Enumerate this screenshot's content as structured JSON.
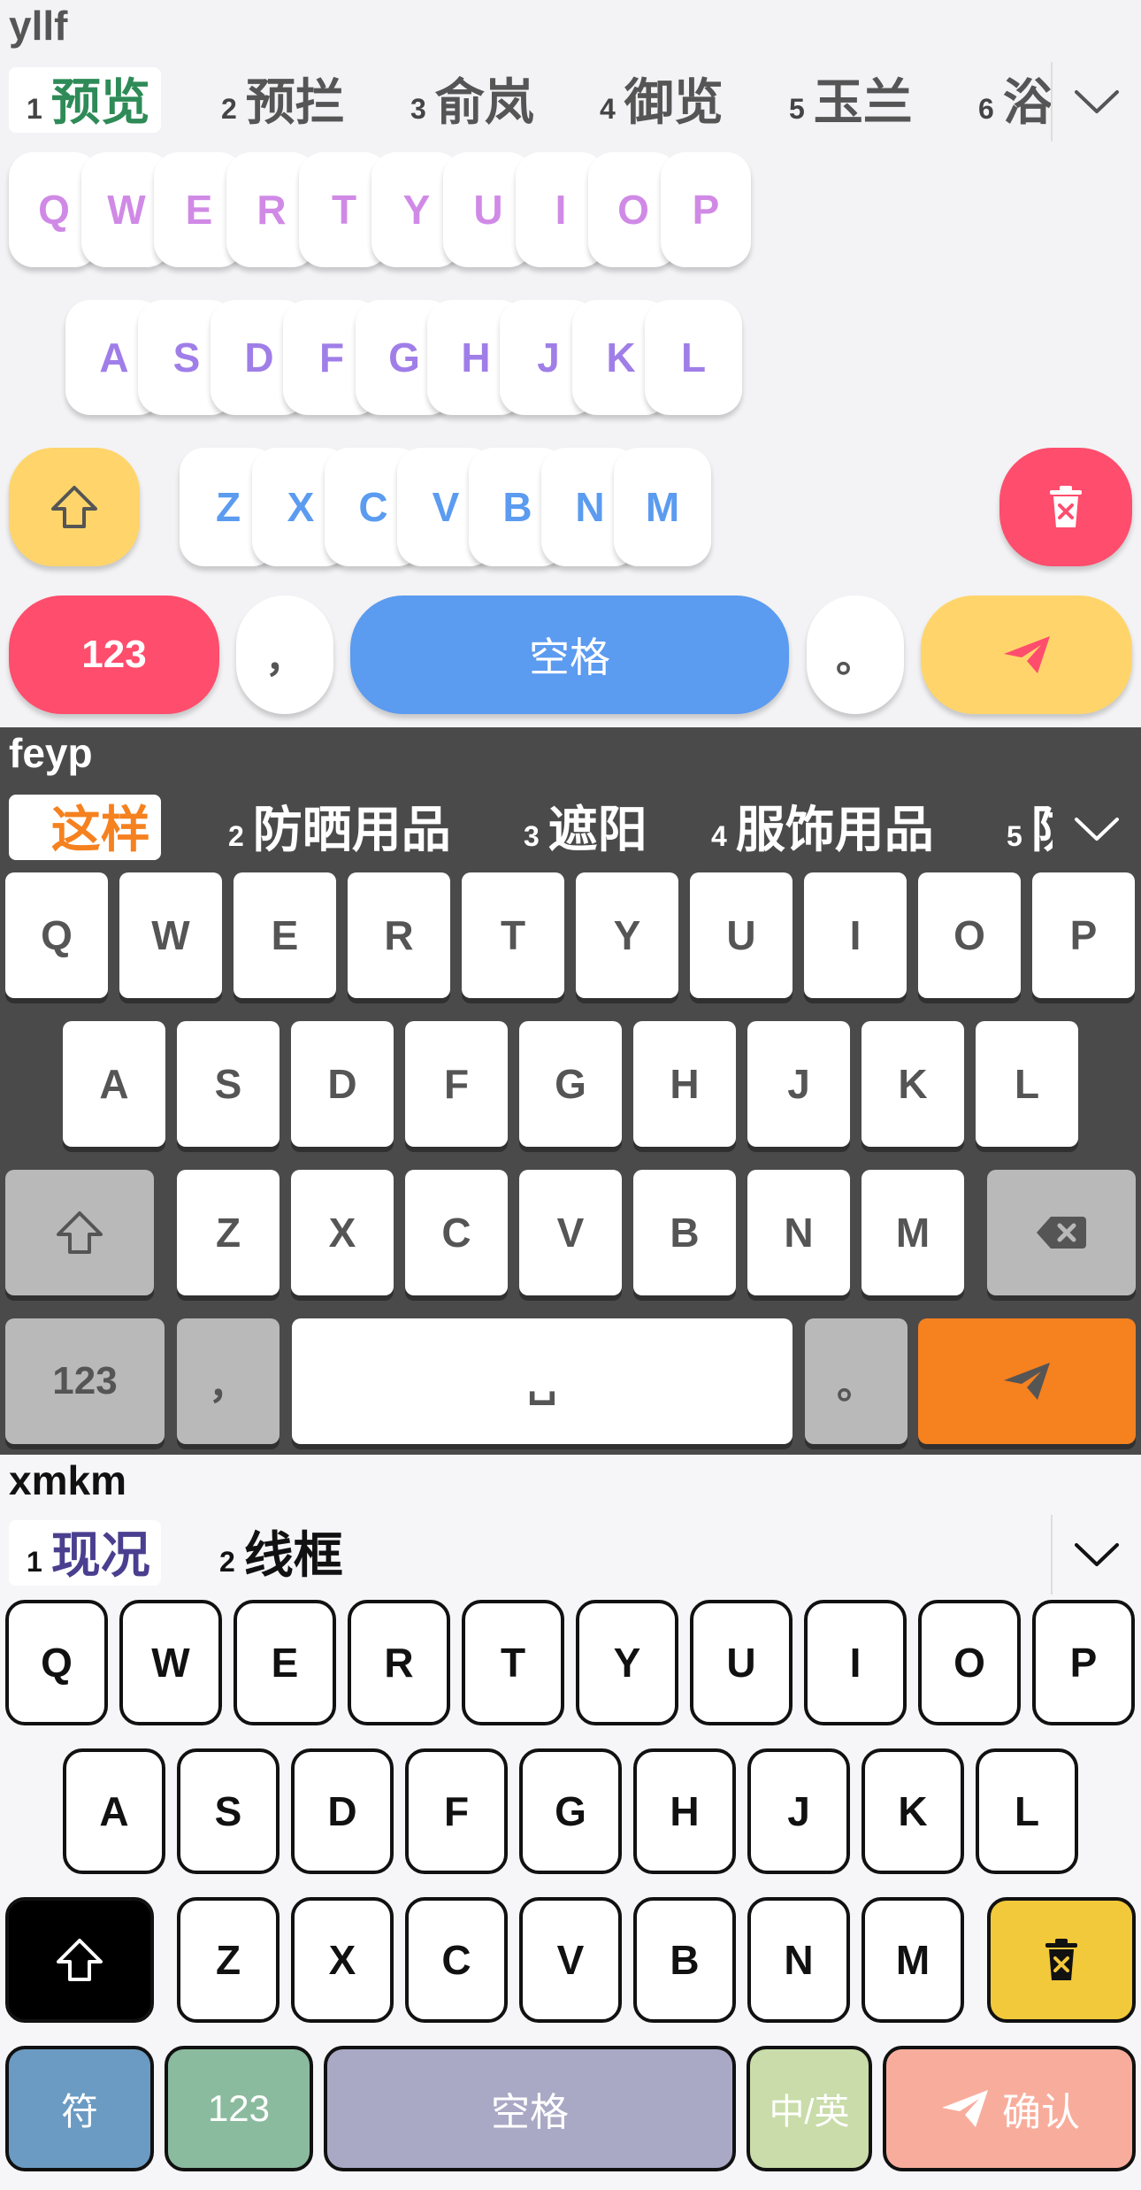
{
  "keyboards": [
    {
      "theme": "light-pastel",
      "composition": "yllf",
      "candidates": [
        {
          "num": "1",
          "text": "预览"
        },
        {
          "num": "2",
          "text": "预拦"
        },
        {
          "num": "3",
          "text": "俞岚"
        },
        {
          "num": "4",
          "text": "御览"
        },
        {
          "num": "5",
          "text": "玉兰"
        },
        {
          "num": "6",
          "text": "浴"
        }
      ],
      "row1": [
        "Q",
        "W",
        "E",
        "R",
        "T",
        "Y",
        "U",
        "I",
        "O",
        "P"
      ],
      "row2": [
        "A",
        "S",
        "D",
        "F",
        "G",
        "H",
        "J",
        "K",
        "L"
      ],
      "row3": [
        "Z",
        "X",
        "C",
        "V",
        "B",
        "N",
        "M"
      ],
      "num_label": "123",
      "comma": "，",
      "space_label": "空格",
      "period": "。",
      "colors": {
        "row1_text": "#d08ae6",
        "row2_text": "#a07ee8",
        "row3_text": "#5b9bf0",
        "shift": "#ffd56b",
        "delete": "#ff4d6d",
        "num": "#ff4d6d",
        "space": "#5b9bf0",
        "send": "#ffd56b",
        "send_icon": "#ff4d6d",
        "selected": "#2e8b57"
      }
    },
    {
      "theme": "dark-gray",
      "composition": "feyp",
      "candidates": [
        {
          "num": "1",
          "text": "这样"
        },
        {
          "num": "2",
          "text": "防晒用品"
        },
        {
          "num": "3",
          "text": "遮阳"
        },
        {
          "num": "4",
          "text": "服饰用品"
        },
        {
          "num": "5",
          "text": "防"
        }
      ],
      "row1": [
        "Q",
        "W",
        "E",
        "R",
        "T",
        "Y",
        "U",
        "I",
        "O",
        "P"
      ],
      "row2": [
        "A",
        "S",
        "D",
        "F",
        "G",
        "H",
        "J",
        "K",
        "L"
      ],
      "row3": [
        "Z",
        "X",
        "C",
        "V",
        "B",
        "N",
        "M"
      ],
      "num_label": "123",
      "comma": "，",
      "space_label": "␣",
      "period": "。",
      "colors": {
        "selected": "#f5811f",
        "send": "#f5811f",
        "special": "#b9b9b9"
      }
    },
    {
      "theme": "outlined",
      "composition": "xmkm",
      "candidates": [
        {
          "num": "1",
          "text": "现况"
        },
        {
          "num": "2",
          "text": "线框"
        }
      ],
      "row1": [
        "Q",
        "W",
        "E",
        "R",
        "T",
        "Y",
        "U",
        "I",
        "O",
        "P"
      ],
      "row2": [
        "A",
        "S",
        "D",
        "F",
        "G",
        "H",
        "J",
        "K",
        "L"
      ],
      "row3": [
        "Z",
        "X",
        "C",
        "V",
        "B",
        "N",
        "M"
      ],
      "symbol_label": "符",
      "num_label": "123",
      "space_label": "空格",
      "lang_label": "中/英",
      "confirm_label": "确认",
      "colors": {
        "selected": "#4a3f8f",
        "shift": "#000000",
        "delete": "#f2c93a",
        "symbol": "#6b9bc3",
        "num": "#8bbb9e",
        "space": "#a9a9c6",
        "lang": "#c9dca9",
        "confirm": "#f8ad9c"
      }
    }
  ]
}
